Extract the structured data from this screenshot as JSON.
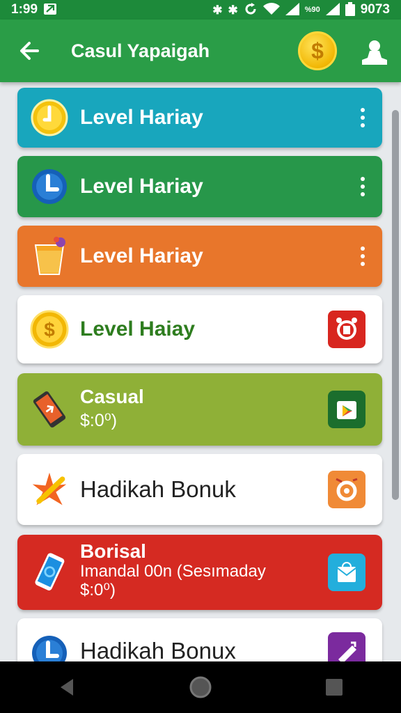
{
  "status_bar": {
    "time": "1:99",
    "network": "%90",
    "battery": "9073"
  },
  "app_bar": {
    "title": "Casul Yapaigah",
    "coin_symbol": "$"
  },
  "list": [
    {
      "title": "Level Hariay",
      "color": "#18a6bd",
      "icon": "yellow-clock-icon",
      "action": "menu"
    },
    {
      "title": "Level Hariay",
      "color": "#27974a",
      "icon": "blue-clock-icon",
      "action": "menu"
    },
    {
      "title": "Level Hariay",
      "color": "#e8762b",
      "icon": "drink-cup-icon",
      "action": "menu"
    },
    {
      "title": "Level Haiay",
      "color": "#ffffff",
      "title_color": "#2e7d1f",
      "icon": "dollar-coin-icon",
      "action": "red-app-icon"
    },
    {
      "title": "Casual",
      "sub": [
        "$:0⁰)"
      ],
      "color": "#8fb037",
      "icon": "smartphone-icon",
      "action": "play-store-icon"
    },
    {
      "title": "Hadikah Bonuk",
      "color": "#ffffff",
      "icon": "orange-star-icon",
      "action": "orange-app-icon"
    },
    {
      "title": "Borisal",
      "sub": [
        "Imandal 00n  (Sesımaday",
        "$:0⁰)"
      ],
      "color": "#d52a22",
      "icon": "blue-phone-icon",
      "action": "mail-bag-icon"
    },
    {
      "title": "Hadikah Bonux",
      "color": "#ffffff",
      "icon": "blue-clock-icon",
      "action": "purple-app-icon"
    }
  ]
}
